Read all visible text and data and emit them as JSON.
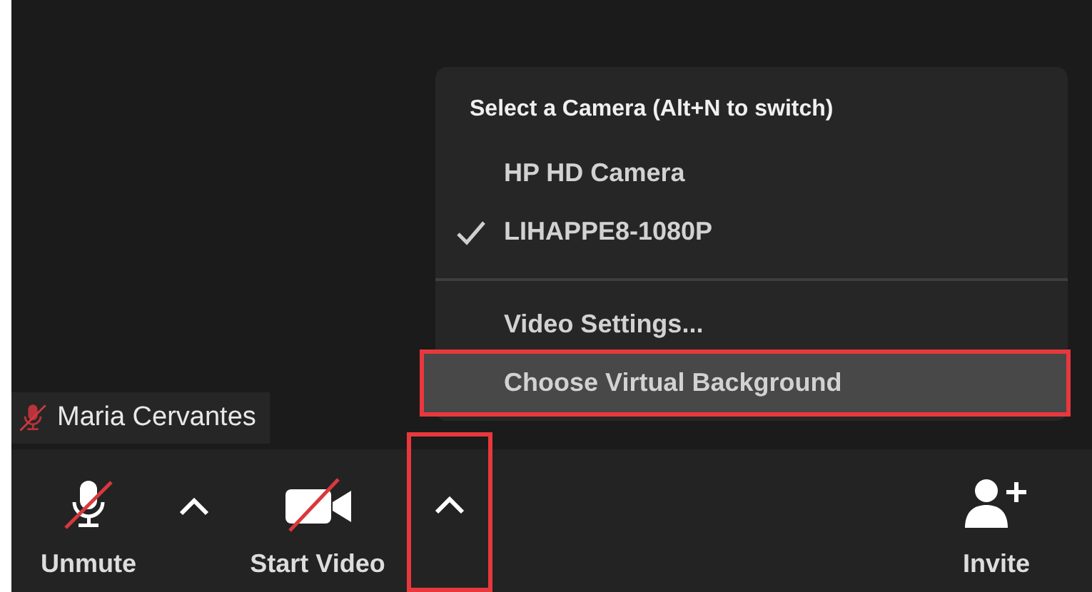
{
  "participant": {
    "name": "Maria Cervantes",
    "muted": true
  },
  "camera_menu": {
    "heading": "Select a Camera (Alt+N to switch)",
    "cameras": [
      {
        "label": "HP HD Camera",
        "checked": false
      },
      {
        "label": "LIHAPPE8-1080P",
        "checked": true
      }
    ],
    "actions": [
      {
        "label": "Video Settings...",
        "highlighted": false
      },
      {
        "label": "Choose Virtual Background",
        "highlighted": true
      }
    ]
  },
  "toolbar": [
    {
      "kind": "mic",
      "label": "Unmute",
      "off": true
    },
    {
      "kind": "caret",
      "highlighted": false
    },
    {
      "kind": "camera",
      "label": "Start Video",
      "off": true
    },
    {
      "kind": "caret",
      "highlighted": true
    },
    {
      "kind": "spacer"
    },
    {
      "kind": "invite",
      "label": "Invite"
    }
  ]
}
